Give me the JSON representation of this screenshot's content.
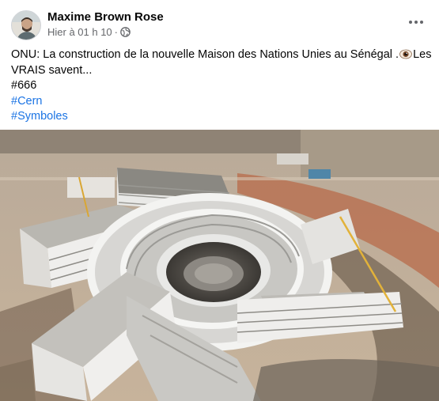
{
  "post": {
    "author_name": "Maxime Brown Rose",
    "timestamp": "Hier à 01 h 10",
    "separator": "·",
    "audience_icon": "globe-icon",
    "more_icon": "more-options-icon",
    "text_line1_before_emoji": "ONU: La construction de la nouvelle Maison des Nations Unies au Sénégal .",
    "text_line1_after_emoji": "Les",
    "text_line2": "VRAIS  savent...",
    "tag_line": "#666",
    "hashtags": [
      "#Cern",
      "#Symboles"
    ],
    "emoji_icon": "eye-emoji-icon",
    "photo_icon": "aerial-building-photo"
  },
  "colors": {
    "link": "#1b74e4",
    "secondary_text": "#65676b",
    "primary_text": "#050505"
  }
}
